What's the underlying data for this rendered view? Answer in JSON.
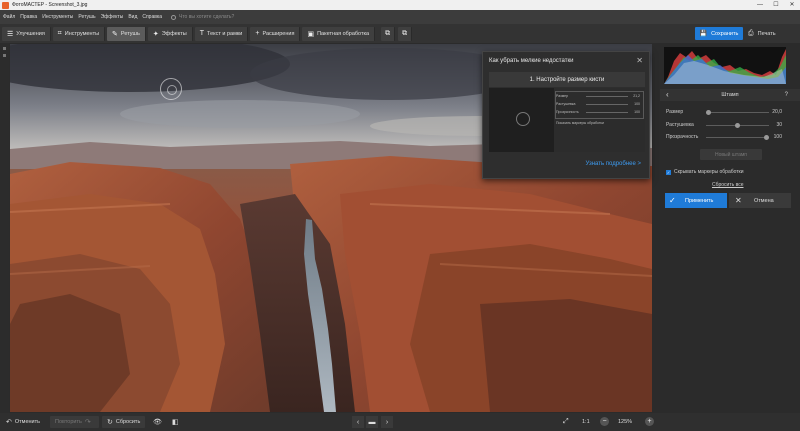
{
  "window": {
    "title": "ФотоМАСТЕР - Screenshot_3.jpg",
    "minimize_glyph": "—",
    "maximize_glyph": "☐",
    "close_glyph": "✕"
  },
  "menu": {
    "items": [
      "Файл",
      "Правка",
      "Инструменты",
      "Ретушь",
      "Эффекты",
      "Вид",
      "Справка"
    ],
    "search_placeholder": "Что вы хотите сделать?"
  },
  "toolbar": {
    "tabs": [
      {
        "label": "Улучшения",
        "icon": "sliders-icon",
        "glyph": "☰",
        "active": false
      },
      {
        "label": "Инструменты",
        "icon": "crop-icon",
        "glyph": "⌗",
        "active": false
      },
      {
        "label": "Ретушь",
        "icon": "brush-icon",
        "glyph": "✎",
        "active": true
      },
      {
        "label": "Эффекты",
        "icon": "magic-icon",
        "glyph": "✦",
        "active": false
      },
      {
        "label": "Текст и рамки",
        "icon": "text-icon",
        "glyph": "T",
        "active": false
      },
      {
        "label": "Расширения",
        "icon": "plus-icon",
        "glyph": "+",
        "active": false
      },
      {
        "label": "Пакетная обработка",
        "icon": "batch-icon",
        "glyph": "▣",
        "active": false
      }
    ],
    "compare_glyph": "⧉",
    "history_glyph": "⧉",
    "save_label": "Сохранить",
    "save_glyph": "💾",
    "print_label": "Печать",
    "print_glyph": "⎙"
  },
  "popup": {
    "title": "Как убрать мелкие недостатки",
    "close_glyph": "✕",
    "step_label": "1. Настройте размер кисти",
    "demo_rows": [
      {
        "label": "Размер",
        "value": "21,2"
      },
      {
        "label": "Растушевка",
        "value": "100"
      },
      {
        "label": "Прозрачность",
        "value": "100"
      }
    ],
    "demo_checkbox": "Показать маркеры обработки",
    "more_link": "Узнать подробнее >"
  },
  "panel": {
    "section_title": "Штамп",
    "back_glyph": "‹",
    "help_glyph": "?",
    "sliders": [
      {
        "label": "Размер",
        "value": "20,0",
        "level": 0.0
      },
      {
        "label": "Растушевка",
        "value": "30",
        "level": 0.5
      },
      {
        "label": "Прозрачность",
        "value": "100",
        "level": 1.0
      }
    ],
    "new_stroke_label": "Новый штамп",
    "show_markers_label": "Скрывать маркеры обработки",
    "show_markers_checked": true,
    "reset_all_label": "Сбросить все",
    "apply_label": "Применить",
    "apply_glyph": "✓",
    "cancel_label": "Отмена",
    "cancel_glyph": "✕"
  },
  "bottombar": {
    "undo_label": "Отменить",
    "undo_glyph": "↶",
    "redo_label": "Повторить",
    "redo_glyph": "↷",
    "reset_label": "Сбросить",
    "reset_glyph": "↻",
    "eye_glyph": "👁",
    "compare_glyph": "◧",
    "prev_glyph": "‹",
    "folder_glyph": "▬",
    "next_glyph": "›",
    "fit_glyph": "⤢",
    "actual_size": "1:1",
    "zoom_out_glyph": "−",
    "zoom_level": "125%",
    "zoom_in_glyph": "+"
  },
  "colors": {
    "accent": "#1f7bd8",
    "background": "#2b2b2b",
    "link": "#3d9bf0"
  }
}
